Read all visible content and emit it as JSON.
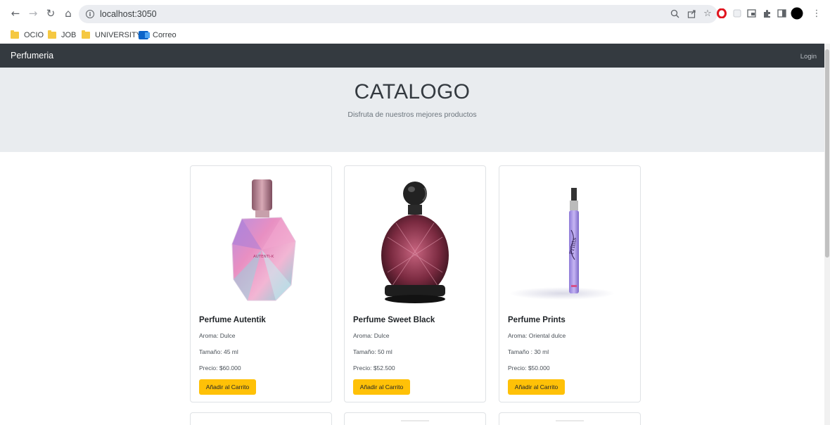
{
  "browser": {
    "url": "localhost:3050",
    "bookmarks": [
      {
        "label": "OCIO",
        "icon": "folder-icon"
      },
      {
        "label": "JOB",
        "icon": "folder-icon"
      },
      {
        "label": "UNIVERSITY",
        "icon": "folder-icon"
      },
      {
        "label": "Correo",
        "icon": "outlook-icon"
      }
    ]
  },
  "navbar": {
    "brand": "Perfumeria",
    "login": "Login"
  },
  "hero": {
    "title": "CATALOGO",
    "subtitle": "Disfruta de nuestros mejores productos"
  },
  "products": [
    {
      "name": "Perfume Autentik",
      "aroma": "Aroma: Dulce",
      "size": "Tamaño: 45 ml",
      "price": "Precio: $60.000",
      "button": "Añadir al Carrito",
      "bottle_label": "AUTENTI-K"
    },
    {
      "name": "Perfume Sweet Black",
      "aroma": "Aroma: Dulce",
      "size": "Tamaño: 50 ml",
      "price": "Precio: $52.500",
      "button": "Añadir al Carrito"
    },
    {
      "name": "Perfume Prints",
      "aroma": "Aroma: Oriental dulce",
      "size": "Tamaño : 30 ml",
      "price": "Precio: $50.000",
      "button": "Añadir al Carrito",
      "bottle_label": "Prints"
    }
  ],
  "colors": {
    "navbar": "#343a40",
    "hero_bg": "#e9ecef",
    "button": "#ffc107"
  }
}
